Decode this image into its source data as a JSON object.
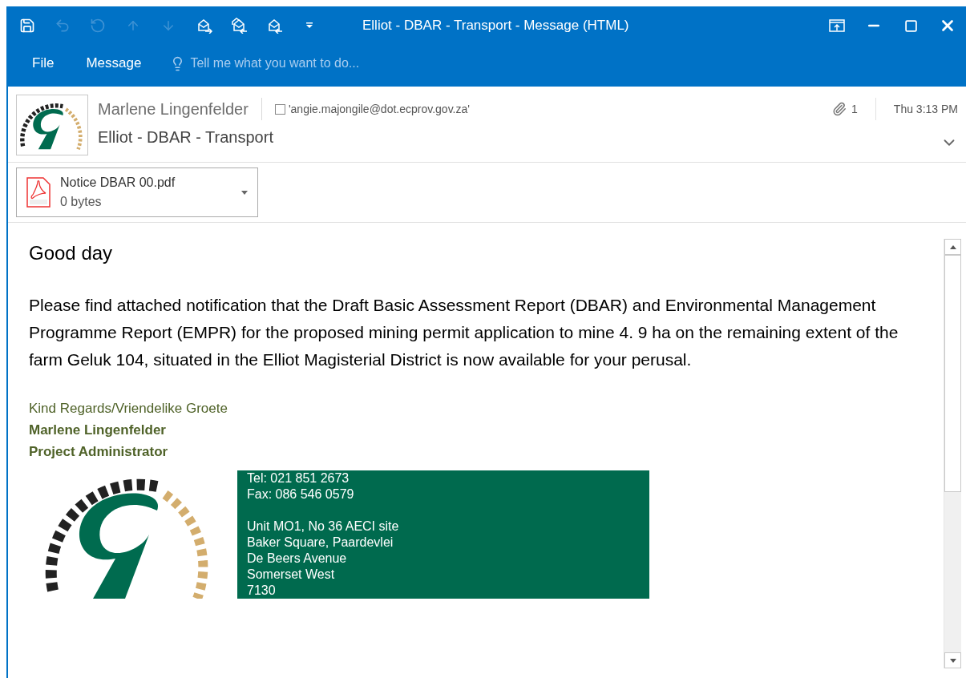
{
  "window": {
    "title": "Elliot - DBAR - Transport - Message (HTML)"
  },
  "quick_access": [
    {
      "kind": "save",
      "disabled": false
    },
    {
      "kind": "undo",
      "disabled": true
    },
    {
      "kind": "redo",
      "disabled": true
    },
    {
      "kind": "up",
      "disabled": true
    },
    {
      "kind": "down",
      "disabled": true
    },
    {
      "kind": "forward",
      "disabled": false
    },
    {
      "kind": "reply_all",
      "disabled": false
    },
    {
      "kind": "reply",
      "disabled": false
    },
    {
      "kind": "customize",
      "disabled": false
    }
  ],
  "ribbon_tabs": [
    {
      "label": "File",
      "selected": false
    },
    {
      "label": "Message",
      "selected": false
    }
  ],
  "tell_me": {
    "placeholder": "Tell me what you want to do..."
  },
  "header": {
    "sender": "Marlene Lingenfelder",
    "to": "'angie.majongile@dot.ecprov.gov.za'",
    "attachment_count": "1",
    "time": "Thu 3:13 PM",
    "subject": "Elliot - DBAR - Transport"
  },
  "attachments": [
    {
      "name": "Notice DBAR 00.pdf",
      "size": "0 bytes"
    }
  ],
  "body": {
    "greeting": "Good day",
    "paragraph": "Please find attached notification that the Draft Basic Assessment Report (DBAR) and Environmental Management Programme Report (EMPR) for the proposed mining permit application to mine 4. 9 ha on the remaining extent of the farm Geluk 104, situated in the Elliot Magisterial District is now available for your perusal.",
    "signature": [
      {
        "text": "Kind Regards/Vriendelike Groete",
        "bold": false
      },
      {
        "text": "Marlene Lingenfelder",
        "bold": true
      },
      {
        "text": "Project Administrator",
        "bold": true
      }
    ],
    "contact_groups": [
      [
        "Tel: 021 851 2673",
        "Fax: 086 546 0579"
      ],
      [
        "Unit MO1, No 36 AECI site",
        "Baker Square, Paardevlei",
        "De Beers Avenue",
        "Somerset West",
        "7130"
      ]
    ]
  }
}
